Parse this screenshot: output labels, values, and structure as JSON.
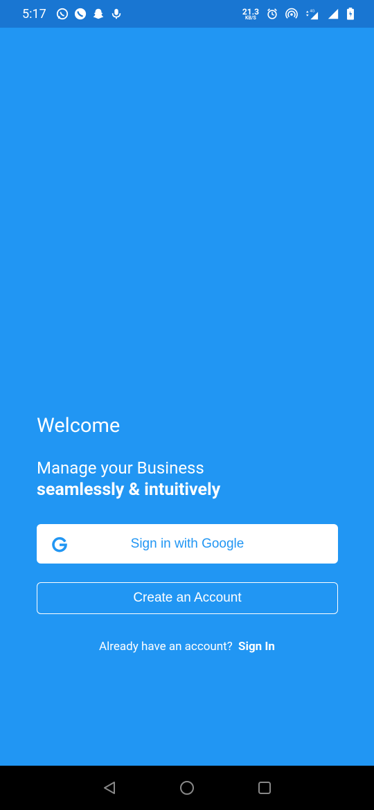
{
  "status_bar": {
    "time": "5:17",
    "net_speed_value": "21.3",
    "net_speed_unit": "KB/S",
    "network_type": "4G",
    "icons": [
      "whatsapp-icon",
      "phone-icon",
      "snapchat-icon",
      "mic-icon",
      "alarm-icon",
      "hotspot-icon",
      "signal-icon",
      "battery-icon"
    ]
  },
  "welcome": {
    "title": "Welcome",
    "tagline": "Manage your Business",
    "tagline_bold": "seamlessly & intuitively"
  },
  "actions": {
    "google_label": "Sign in with Google",
    "create_label": "Create an Account",
    "signin_prompt": "Already have an account?",
    "signin_link": "Sign In"
  },
  "colors": {
    "background": "#2196F3",
    "status_bar": "#1976D2",
    "google_g": "#2196F3"
  }
}
